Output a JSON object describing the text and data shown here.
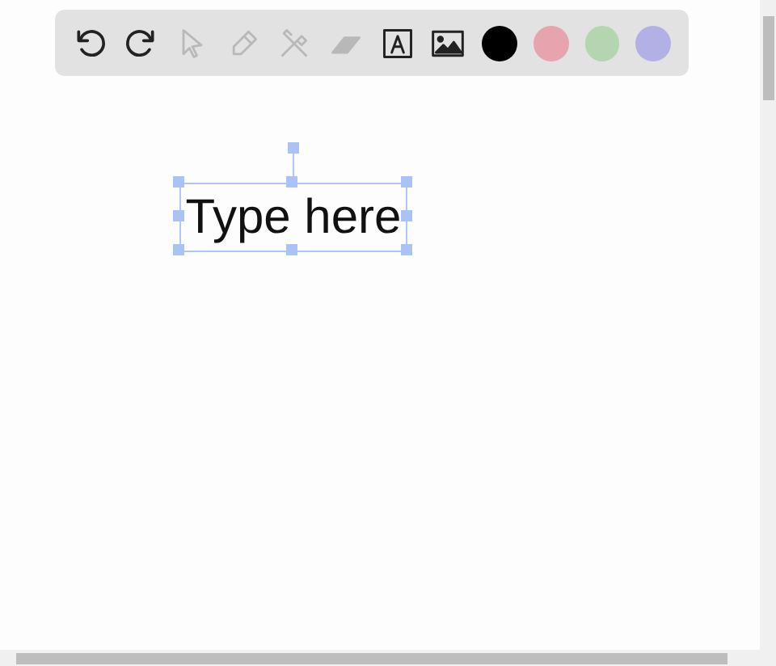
{
  "toolbar": {
    "tools": [
      {
        "kind": "undo",
        "disabled": false
      },
      {
        "kind": "redo",
        "disabled": false
      },
      {
        "kind": "pointer",
        "disabled": true
      },
      {
        "kind": "pencil",
        "disabled": true
      },
      {
        "kind": "tools",
        "disabled": true
      },
      {
        "kind": "eraser",
        "disabled": true
      },
      {
        "kind": "text",
        "disabled": false
      },
      {
        "kind": "image",
        "disabled": false
      }
    ],
    "colors": [
      {
        "color": "#000000"
      },
      {
        "color": "#e6a4ae"
      },
      {
        "color": "#b3d6b0"
      },
      {
        "color": "#b3b0e6"
      }
    ]
  },
  "canvas": {
    "text_box": {
      "text": "Type here"
    }
  }
}
